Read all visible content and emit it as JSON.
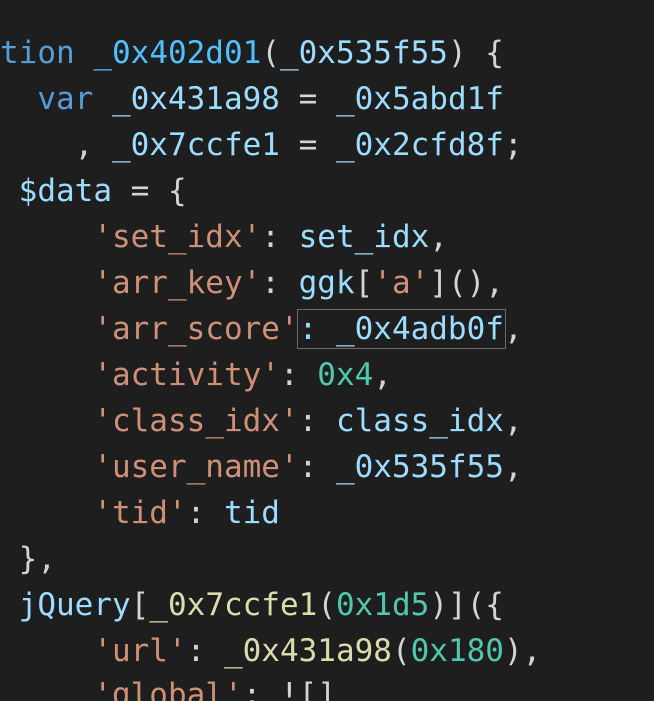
{
  "code_lines": [
    {
      "id": "l0",
      "tokens": [
        {
          "t": "tion ",
          "c": "kw"
        },
        {
          "t": "_0x402d01",
          "c": "fnname"
        },
        {
          "t": "(",
          "c": "punc"
        },
        {
          "t": "_0x535f55",
          "c": "var"
        },
        {
          "t": ") {",
          "c": "punc"
        }
      ]
    },
    {
      "id": "l1",
      "tokens": [
        {
          "t": "  var ",
          "c": "kw"
        },
        {
          "t": "_0x431a98",
          "c": "var"
        },
        {
          "t": " = ",
          "c": "punc"
        },
        {
          "t": "_0x5abd1f",
          "c": "var"
        }
      ]
    },
    {
      "id": "l2",
      "tokens": [
        {
          "t": "    , ",
          "c": "punc"
        },
        {
          "t": "_0x7ccfe1",
          "c": "var"
        },
        {
          "t": " = ",
          "c": "punc"
        },
        {
          "t": "_0x2cfd8f",
          "c": "var"
        },
        {
          "t": ";",
          "c": "punc"
        }
      ]
    },
    {
      "id": "l3",
      "tokens": [
        {
          "t": " $data",
          "c": "var"
        },
        {
          "t": " = {",
          "c": "punc"
        }
      ]
    },
    {
      "id": "l4",
      "tokens": [
        {
          "t": "     'set_idx'",
          "c": "str"
        },
        {
          "t": ": ",
          "c": "punc"
        },
        {
          "t": "set_idx",
          "c": "var"
        },
        {
          "t": ",",
          "c": "punc"
        }
      ]
    },
    {
      "id": "l5",
      "tokens": [
        {
          "t": "     'arr_key'",
          "c": "str"
        },
        {
          "t": ": ",
          "c": "punc"
        },
        {
          "t": "ggk",
          "c": "var"
        },
        {
          "t": "[",
          "c": "punc"
        },
        {
          "t": "'a'",
          "c": "str"
        },
        {
          "t": "](),",
          "c": "punc"
        }
      ]
    },
    {
      "id": "l6",
      "tokens": [
        {
          "t": "     'arr_score'",
          "c": "str"
        },
        {
          "t": ": _0x4adb0f",
          "c": "var",
          "boxed": true
        },
        {
          "t": ",",
          "c": "punc"
        }
      ]
    },
    {
      "id": "l7",
      "tokens": [
        {
          "t": "     'activity'",
          "c": "str"
        },
        {
          "t": ": ",
          "c": "punc"
        },
        {
          "t": "0x4",
          "c": "hex"
        },
        {
          "t": ",",
          "c": "punc"
        }
      ]
    },
    {
      "id": "l8",
      "tokens": [
        {
          "t": "     'class_idx'",
          "c": "str"
        },
        {
          "t": ": ",
          "c": "punc"
        },
        {
          "t": "class_idx",
          "c": "var"
        },
        {
          "t": ",",
          "c": "punc"
        }
      ]
    },
    {
      "id": "l9",
      "tokens": [
        {
          "t": "     'user_name'",
          "c": "str"
        },
        {
          "t": ": ",
          "c": "punc"
        },
        {
          "t": "_0x535f55",
          "c": "var"
        },
        {
          "t": ",",
          "c": "punc"
        }
      ]
    },
    {
      "id": "l10",
      "tokens": [
        {
          "t": "     'tid'",
          "c": "str"
        },
        {
          "t": ": ",
          "c": "punc"
        },
        {
          "t": "tid",
          "c": "var"
        }
      ]
    },
    {
      "id": "l11",
      "tokens": [
        {
          "t": " },",
          "c": "punc"
        }
      ]
    },
    {
      "id": "l12",
      "tokens": [
        {
          "t": " jQuery",
          "c": "var"
        },
        {
          "t": "[",
          "c": "punc"
        },
        {
          "t": "_0x7ccfe1",
          "c": "fn"
        },
        {
          "t": "(",
          "c": "punc"
        },
        {
          "t": "0x1d5",
          "c": "hex"
        },
        {
          "t": ")]({",
          "c": "punc"
        }
      ]
    },
    {
      "id": "l13",
      "tokens": [
        {
          "t": "     'url'",
          "c": "str"
        },
        {
          "t": ": ",
          "c": "punc"
        },
        {
          "t": "_0x431a98",
          "c": "fn"
        },
        {
          "t": "(",
          "c": "punc"
        },
        {
          "t": "0x180",
          "c": "hex"
        },
        {
          "t": "),",
          "c": "punc"
        }
      ]
    },
    {
      "id": "l14",
      "tokens": [
        {
          "t": "     'global'",
          "c": "str"
        },
        {
          "t": ": ",
          "c": "punc"
        },
        {
          "t": "![]",
          "c": "punc"
        }
      ]
    }
  ]
}
